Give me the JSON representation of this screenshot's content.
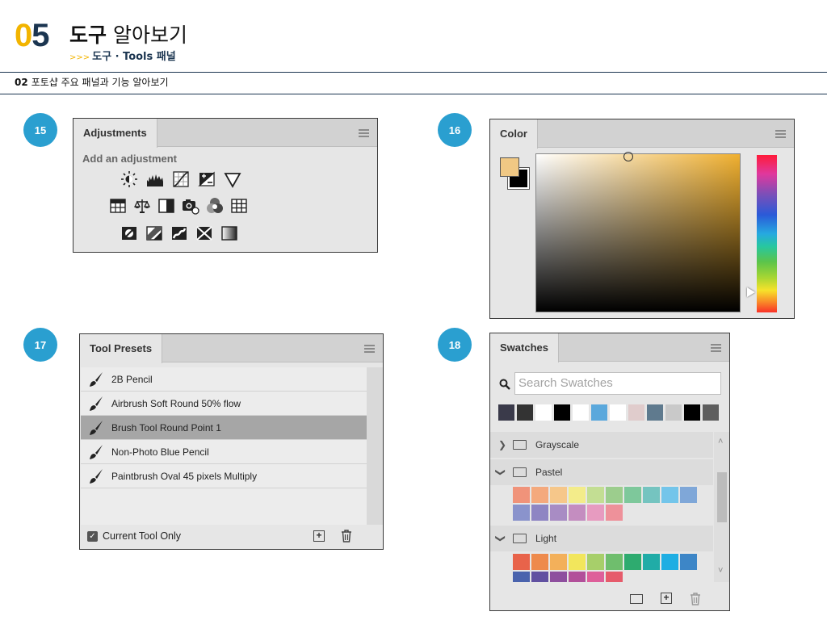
{
  "header": {
    "chapter_number_first": "0",
    "chapter_number_second": "5",
    "title_bold": "도구",
    "title_light": "알아보기",
    "subtitle_arrow": ">>>",
    "subtitle": "도구 · Tools 패널",
    "section_number": "02",
    "section_title": "포토샵 주요 패널과 기능 알아보기"
  },
  "badges": [
    "15",
    "16",
    "17",
    "18"
  ],
  "adjustments": {
    "tab": "Adjustments",
    "heading": "Add an adjustment",
    "icons_row1": [
      "brightness-contrast-icon",
      "levels-icon",
      "curves-icon",
      "exposure-icon",
      "vibrance-icon"
    ],
    "icons_row2": [
      "hue-saturation-icon",
      "color-balance-icon",
      "black-white-icon",
      "photo-filter-icon",
      "channel-mixer-icon",
      "color-lookup-icon"
    ],
    "icons_row3": [
      "invert-icon",
      "posterize-icon",
      "threshold-icon",
      "selective-color-icon",
      "gradient-map-icon"
    ]
  },
  "color": {
    "tab": "Color",
    "foreground": "#f0c884",
    "background": "#000000"
  },
  "tool_presets": {
    "tab": "Tool Presets",
    "items": [
      {
        "label": "2B Pencil",
        "selected": false
      },
      {
        "label": "Airbrush Soft Round 50% flow",
        "selected": false
      },
      {
        "label": "Brush Tool Round Point 1",
        "selected": true
      },
      {
        "label": "Non-Photo Blue Pencil",
        "selected": false
      },
      {
        "label": "Paintbrush Oval 45 pixels Multiply",
        "selected": false
      }
    ],
    "current_tool_only_label": "Current Tool Only",
    "current_tool_only_checked": true
  },
  "swatches": {
    "tab": "Swatches",
    "search_placeholder": "Search Swatches",
    "recent": [
      "#3a3a4a",
      "#333333",
      "#ffffff",
      "#000000",
      "#ffffff",
      "#5aa8dc",
      "#ffffff",
      "#e0cccc",
      "#5f7a8e",
      "#c9c9c9",
      "#000000",
      "#5e5e5e"
    ],
    "groups": [
      {
        "name": "Grayscale",
        "expanded": false
      },
      {
        "name": "Pastel",
        "expanded": true,
        "colors": [
          "#f0937a",
          "#f4a97d",
          "#f6c78a",
          "#f3ec8a",
          "#c3de93",
          "#9ccd8d",
          "#7ec89b",
          "#75c4c0",
          "#73c5ea",
          "#7fa7d8",
          "#8a93cc",
          "#8e85c3",
          "#a88cc4",
          "#c48dc0",
          "#e79bc0",
          "#ee919a"
        ]
      },
      {
        "name": "Light",
        "expanded": true,
        "colors": [
          "#e8634a",
          "#ee8a4c",
          "#f3b05a",
          "#f2e65c",
          "#a7cf6a",
          "#6fbe6d",
          "#2eab6f",
          "#20aca7",
          "#1eaee3",
          "#3d86c7",
          "#4a63ad",
          "#6151a1",
          "#8e4f9e",
          "#b2509a",
          "#de5f9a",
          "#e65b6b"
        ]
      }
    ]
  }
}
